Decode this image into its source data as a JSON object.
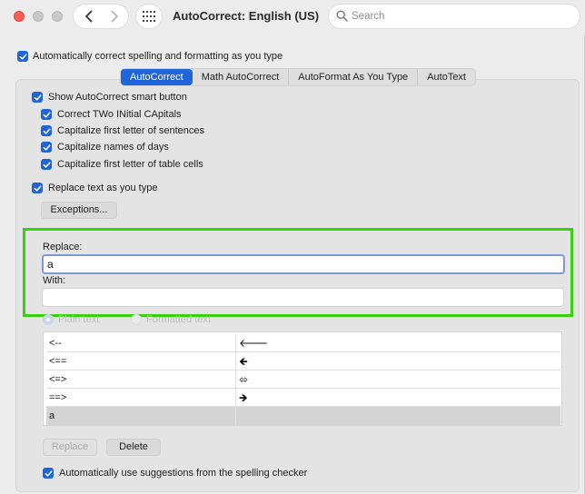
{
  "window": {
    "title": "AutoCorrect: English (US)",
    "search_placeholder": "Search"
  },
  "options": {
    "auto_correct": "Automatically correct spelling and formatting as you type"
  },
  "tabs": [
    {
      "label": "AutoCorrect",
      "active": true
    },
    {
      "label": "Math AutoCorrect",
      "active": false
    },
    {
      "label": "AutoFormat As You Type",
      "active": false
    },
    {
      "label": "AutoText",
      "active": false
    }
  ],
  "panel": {
    "show_smart_button": "Show AutoCorrect smart button",
    "correct_two_initial": "Correct TWo INitial CApitals",
    "capitalize_sentences": "Capitalize first letter of sentences",
    "capitalize_days": "Capitalize names of days",
    "capitalize_table_cells": "Capitalize first letter of table cells",
    "replace_text": "Replace text as you type",
    "exceptions_button": "Exceptions...",
    "replace_label": "Replace:",
    "replace_value": "a",
    "with_label": "With:",
    "with_value": "",
    "plain_text": "Plain text",
    "formatted_text": "Formatted text",
    "replace_button": "Replace",
    "delete_button": "Delete",
    "auto_suggestions": "Automatically use suggestions from the spelling checker"
  },
  "entries": [
    {
      "replace": "<--",
      "with": "🡐"
    },
    {
      "replace": "<==",
      "with": "🡸"
    },
    {
      "replace": "<=>",
      "with": "⬄"
    },
    {
      "replace": "==>",
      "with": "🡺"
    },
    {
      "replace": "a",
      "with": ""
    }
  ],
  "colors": {
    "accent": "#1f64d8",
    "highlight": "#39d10f"
  }
}
